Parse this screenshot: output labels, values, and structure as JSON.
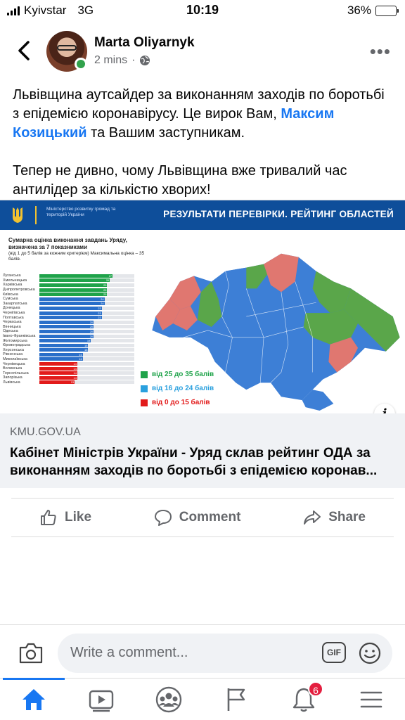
{
  "status_bar": {
    "carrier": "Kyivstar",
    "network": "3G",
    "time": "10:19",
    "battery": "36%",
    "battery_level": 0.36
  },
  "header": {
    "author": "Marta Oliyarnyk",
    "time_ago": "2 mins",
    "privacy_icon": "globe-icon",
    "more_label": "•••"
  },
  "post": {
    "p1_before": "Львівщина аутсайдер за виконанням заходів по боротьбі з епідемією коронавірусу. Це вирок Вам, ",
    "p1_tag": "Максим Козицький",
    "p1_after": " та Вашим заступникам.",
    "p2": "Тепер не дивно, чому Львівщина вже тривалий час антилідер за кількістю хворих!"
  },
  "link_card": {
    "image": {
      "ministry": "Міністерство розвитку громад та територій України",
      "banner_title": "РЕЗУЛЬТАТИ ПЕРЕВІРКИ. РЕЙТИНГ ОБЛАСТЕЙ",
      "subtitle": "Сумарна оцінка виконання завдань Уряду, визначена за 7 показниками",
      "subnote": "(від 1 до 5 балів за кожним критерієм) Максимальна оцінка – 35 балів.",
      "ranking": [
        {
          "name": "Луганська",
          "value": 27
        },
        {
          "name": "Хмельницька",
          "value": 26
        },
        {
          "name": "Харківська",
          "value": 25
        },
        {
          "name": "Дніпропетровська",
          "value": 25
        },
        {
          "name": "Київська",
          "value": 25
        },
        {
          "name": "Сумська",
          "value": 24
        },
        {
          "name": "Закарпатська",
          "value": 24
        },
        {
          "name": "Донецька",
          "value": 23
        },
        {
          "name": "Чернігівська",
          "value": 23
        },
        {
          "name": "Полтавська",
          "value": 23
        },
        {
          "name": "Черкаська",
          "value": 20
        },
        {
          "name": "Вінницька",
          "value": 20
        },
        {
          "name": "Одеська",
          "value": 20
        },
        {
          "name": "Івано-Франківська",
          "value": 20
        },
        {
          "name": "Житомирська",
          "value": 19
        },
        {
          "name": "Кіровоградська",
          "value": 18
        },
        {
          "name": "Херсонська",
          "value": 18
        },
        {
          "name": "Рівненська",
          "value": 16
        },
        {
          "name": "Миколаївська",
          "value": 16
        },
        {
          "name": "Чернівецька",
          "value": 14
        },
        {
          "name": "Волинська",
          "value": 14
        },
        {
          "name": "Тернопільська",
          "value": 14
        },
        {
          "name": "Запорізька",
          "value": 14
        },
        {
          "name": "Львівська",
          "value": 13
        }
      ],
      "legend": [
        {
          "label": "від 25 до 35 балів",
          "color": "#1fa34a"
        },
        {
          "label": "від 16 до 24 балів",
          "color": "#2aa0de"
        },
        {
          "label": "від 0 до 15 балів",
          "color": "#e21b1b"
        }
      ],
      "map_colors": {
        "green": "#5aa64a",
        "blue": "#3d7fd6",
        "red": "#e07770"
      }
    },
    "domain": "KMU.GOV.UA",
    "title": "Кабінет Міністрів України - Уряд склав рейтинг ОДА за виконанням заходів по боротьбі з епідемією коронав..."
  },
  "actions": {
    "like": "Like",
    "comment": "Comment",
    "share": "Share"
  },
  "comment_bar": {
    "placeholder": "Write a comment...",
    "gif_label": "GIF"
  },
  "tabbar": {
    "notifications_badge": "6"
  }
}
